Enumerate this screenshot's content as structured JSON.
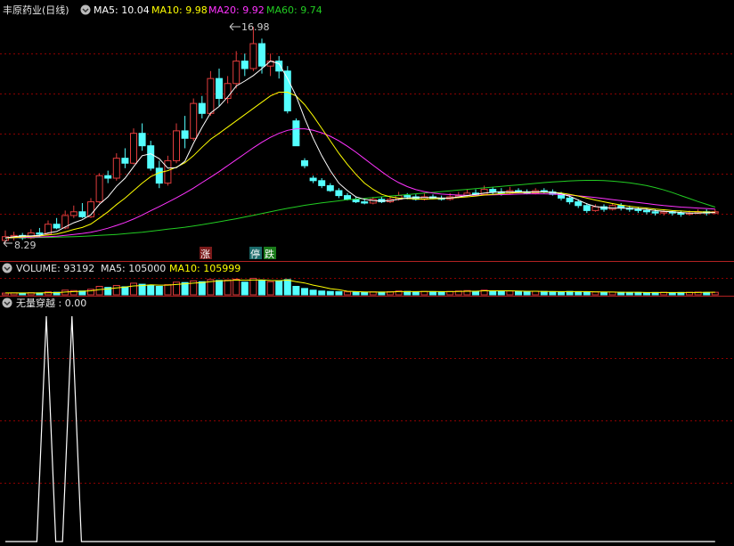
{
  "colors": {
    "bg": "#000000",
    "up": "#e03c3c",
    "down": "#54ffff",
    "ma5": "#ffffff",
    "ma10": "#ffff00",
    "ma20": "#ff33ff",
    "ma60": "#22cc22",
    "grid": "#8b0000",
    "panel_border": "#b22222",
    "label": "#e6e6e6",
    "zhang_bg": "#7a1a1a",
    "ting_bg": "#1a6a6a",
    "die_bg": "#1a7a1a"
  },
  "main": {
    "title": "丰原药业(日线)",
    "ma5_label": "MA5: 10.04",
    "ma10_label": "MA10: 9.98",
    "ma20_label": "MA20: 9.92",
    "ma60_label": "MA60: 9.74",
    "high_label": "16.98",
    "low_label": "8.29",
    "tag_zhang": "涨",
    "tag_ting": "停",
    "tag_die": "跌"
  },
  "volume": {
    "title": "VOLUME: 93192",
    "ma5_label": "MA5: 105000",
    "ma10_label": "MA10: 105999"
  },
  "indicator": {
    "title": "无量穿越 : 0.00"
  },
  "chart_data": {
    "type": "candlestick",
    "price_range": [
      8.29,
      16.98
    ],
    "candles": [
      [
        8.4,
        8.55,
        8.8,
        8.3
      ],
      [
        8.55,
        8.6,
        8.75,
        8.4
      ],
      [
        8.6,
        8.5,
        8.7,
        8.42
      ],
      [
        8.5,
        8.7,
        8.85,
        8.45
      ],
      [
        8.7,
        8.65,
        8.9,
        8.55
      ],
      [
        8.65,
        9.05,
        9.2,
        8.6
      ],
      [
        9.05,
        8.9,
        9.3,
        8.85
      ],
      [
        8.9,
        9.4,
        9.6,
        8.85
      ],
      [
        9.4,
        9.55,
        9.8,
        9.3
      ],
      [
        9.55,
        9.35,
        9.9,
        9.3
      ],
      [
        9.35,
        9.95,
        10.1,
        9.3
      ],
      [
        9.95,
        11.0,
        11.1,
        9.9
      ],
      [
        11.0,
        10.9,
        11.2,
        10.7
      ],
      [
        10.9,
        11.7,
        11.9,
        10.8
      ],
      [
        11.7,
        11.5,
        12.1,
        11.3
      ],
      [
        11.5,
        12.7,
        12.9,
        11.45
      ],
      [
        12.7,
        12.2,
        13.1,
        12.0
      ],
      [
        12.2,
        11.3,
        12.4,
        11.2
      ],
      [
        11.3,
        10.7,
        11.6,
        10.5
      ],
      [
        10.7,
        11.6,
        11.8,
        10.6
      ],
      [
        11.6,
        12.8,
        13.1,
        11.5
      ],
      [
        12.8,
        12.5,
        13.4,
        12.1
      ],
      [
        12.5,
        13.9,
        14.1,
        12.4
      ],
      [
        13.9,
        13.5,
        14.2,
        13.3
      ],
      [
        13.5,
        14.9,
        15.2,
        13.4
      ],
      [
        14.9,
        14.1,
        15.3,
        13.8
      ],
      [
        14.1,
        14.7,
        15.0,
        13.9
      ],
      [
        14.7,
        15.6,
        16.0,
        14.5
      ],
      [
        15.6,
        15.3,
        15.9,
        15.0
      ],
      [
        15.3,
        16.3,
        16.98,
        15.2
      ],
      [
        16.3,
        15.4,
        16.5,
        15.1
      ],
      [
        15.4,
        15.6,
        15.9,
        15.0
      ],
      [
        15.6,
        15.2,
        15.8,
        14.9
      ],
      [
        15.2,
        13.6,
        15.4,
        13.5
      ],
      [
        13.2,
        12.2,
        13.3,
        12.2
      ],
      [
        11.6,
        11.4,
        11.7,
        11.3
      ],
      [
        10.9,
        10.8,
        11.0,
        10.7
      ],
      [
        10.8,
        10.6,
        10.9,
        10.5
      ],
      [
        10.6,
        10.4,
        10.7,
        10.35
      ],
      [
        10.4,
        10.2,
        10.5,
        10.1
      ],
      [
        10.2,
        10.05,
        10.3,
        10.0
      ],
      [
        10.05,
        9.95,
        10.15,
        9.9
      ],
      [
        9.95,
        9.9,
        10.1,
        9.85
      ],
      [
        9.9,
        10.05,
        10.15,
        9.85
      ],
      [
        10.05,
        9.95,
        10.15,
        9.9
      ],
      [
        9.95,
        10.05,
        10.2,
        9.9
      ],
      [
        10.05,
        10.2,
        10.35,
        10.0
      ],
      [
        10.2,
        10.15,
        10.3,
        10.05
      ],
      [
        10.15,
        10.05,
        10.25,
        10.0
      ],
      [
        10.05,
        10.15,
        10.3,
        10.0
      ],
      [
        10.15,
        10.1,
        10.25,
        10.05
      ],
      [
        10.1,
        10.05,
        10.2,
        10.0
      ],
      [
        10.05,
        10.15,
        10.3,
        10.0
      ],
      [
        10.15,
        10.2,
        10.35,
        10.1
      ],
      [
        10.2,
        10.3,
        10.45,
        10.15
      ],
      [
        10.3,
        10.25,
        10.45,
        10.2
      ],
      [
        10.25,
        10.45,
        10.6,
        10.2
      ],
      [
        10.45,
        10.35,
        10.55,
        10.25
      ],
      [
        10.35,
        10.3,
        10.5,
        10.2
      ],
      [
        10.3,
        10.4,
        10.55,
        10.25
      ],
      [
        10.4,
        10.35,
        10.5,
        10.3
      ],
      [
        10.35,
        10.3,
        10.45,
        10.25
      ],
      [
        10.3,
        10.4,
        10.5,
        10.25
      ],
      [
        10.4,
        10.35,
        10.5,
        10.3
      ],
      [
        10.35,
        10.25,
        10.45,
        10.2
      ],
      [
        10.25,
        10.1,
        10.35,
        10.0
      ],
      [
        10.1,
        9.95,
        10.2,
        9.85
      ],
      [
        9.95,
        9.8,
        10.05,
        9.7
      ],
      [
        9.8,
        9.6,
        9.9,
        9.5
      ],
      [
        9.6,
        9.75,
        9.85,
        9.55
      ],
      [
        9.75,
        9.65,
        9.85,
        9.55
      ],
      [
        9.65,
        9.8,
        9.9,
        9.6
      ],
      [
        9.8,
        9.7,
        9.9,
        9.6
      ],
      [
        9.7,
        9.65,
        9.8,
        9.55
      ],
      [
        9.65,
        9.6,
        9.75,
        9.5
      ],
      [
        9.6,
        9.55,
        9.7,
        9.45
      ],
      [
        9.55,
        9.5,
        9.65,
        9.4
      ],
      [
        9.5,
        9.55,
        9.65,
        9.4
      ],
      [
        9.55,
        9.5,
        9.6,
        9.4
      ],
      [
        9.5,
        9.45,
        9.6,
        9.35
      ],
      [
        9.45,
        9.5,
        9.6,
        9.4
      ],
      [
        9.5,
        9.55,
        9.65,
        9.45
      ],
      [
        9.55,
        9.5,
        9.65,
        9.4
      ],
      [
        9.5,
        9.55,
        9.65,
        9.45
      ]
    ],
    "ma5": [
      8.5,
      8.55,
      8.58,
      8.58,
      8.6,
      8.7,
      8.76,
      8.94,
      9.11,
      9.23,
      9.43,
      9.85,
      10.15,
      10.57,
      10.9,
      11.36,
      11.8,
      11.88,
      11.68,
      11.3,
      11.32,
      11.58,
      12.3,
      12.94,
      13.52,
      13.78,
      14.16,
      14.6,
      14.8,
      15.02,
      15.3,
      15.6,
      15.5,
      14.9,
      14.2,
      13.3,
      12.5,
      11.8,
      11.2,
      10.7,
      10.4,
      10.15,
      10.05,
      10.0,
      9.98,
      10.0,
      10.05,
      10.1,
      10.12,
      10.12,
      10.12,
      10.1,
      10.1,
      10.15,
      10.2,
      10.25,
      10.3,
      10.33,
      10.35,
      10.35,
      10.35,
      10.35,
      10.35,
      10.35,
      10.33,
      10.27,
      10.17,
      10.02,
      9.87,
      9.76,
      9.72,
      9.7,
      9.7,
      9.69,
      9.67,
      9.65,
      9.6,
      9.57,
      9.55,
      9.52,
      9.5,
      9.5,
      9.51,
      9.52
    ],
    "ma10": [
      8.5,
      8.52,
      8.54,
      8.56,
      8.58,
      8.62,
      8.66,
      8.74,
      8.84,
      8.92,
      9.06,
      9.3,
      9.55,
      9.84,
      10.1,
      10.4,
      10.7,
      10.96,
      11.12,
      11.2,
      11.34,
      11.52,
      11.8,
      12.14,
      12.46,
      12.7,
      12.95,
      13.2,
      13.45,
      13.7,
      13.95,
      14.2,
      14.35,
      14.35,
      14.2,
      13.85,
      13.4,
      12.9,
      12.4,
      11.9,
      11.45,
      11.05,
      10.7,
      10.45,
      10.25,
      10.15,
      10.1,
      10.08,
      10.06,
      10.06,
      10.07,
      10.08,
      10.1,
      10.12,
      10.15,
      10.18,
      10.22,
      10.25,
      10.28,
      10.3,
      10.32,
      10.33,
      10.34,
      10.34,
      10.33,
      10.3,
      10.25,
      10.18,
      10.1,
      10.02,
      9.95,
      9.88,
      9.82,
      9.77,
      9.73,
      9.7,
      9.66,
      9.63,
      9.6,
      9.58,
      9.56,
      9.55,
      9.54,
      9.53
    ],
    "ma20": [
      8.5,
      8.51,
      8.52,
      8.53,
      8.54,
      8.55,
      8.57,
      8.6,
      8.64,
      8.68,
      8.73,
      8.8,
      8.89,
      9.0,
      9.12,
      9.26,
      9.42,
      9.59,
      9.76,
      9.93,
      10.11,
      10.3,
      10.5,
      10.72,
      10.94,
      11.16,
      11.4,
      11.64,
      11.88,
      12.12,
      12.34,
      12.54,
      12.7,
      12.82,
      12.88,
      12.88,
      12.82,
      12.72,
      12.58,
      12.4,
      12.18,
      11.94,
      11.68,
      11.42,
      11.16,
      10.92,
      10.72,
      10.56,
      10.44,
      10.36,
      10.3,
      10.26,
      10.24,
      10.22,
      10.21,
      10.21,
      10.22,
      10.23,
      10.24,
      10.25,
      10.26,
      10.27,
      10.27,
      10.27,
      10.26,
      10.24,
      10.22,
      10.19,
      10.16,
      10.12,
      10.08,
      10.04,
      10.0,
      9.96,
      9.92,
      9.88,
      9.84,
      9.8,
      9.77,
      9.74,
      9.72,
      9.7,
      9.68,
      9.66
    ],
    "ma60": [
      8.5,
      8.5,
      8.51,
      8.51,
      8.52,
      8.52,
      8.53,
      8.54,
      8.55,
      8.56,
      8.58,
      8.6,
      8.62,
      8.64,
      8.67,
      8.7,
      8.73,
      8.77,
      8.81,
      8.85,
      8.89,
      8.93,
      8.98,
      9.03,
      9.09,
      9.15,
      9.21,
      9.27,
      9.34,
      9.41,
      9.48,
      9.55,
      9.62,
      9.69,
      9.75,
      9.81,
      9.86,
      9.91,
      9.95,
      9.99,
      10.03,
      10.06,
      10.09,
      10.12,
      10.15,
      10.18,
      10.21,
      10.24,
      10.27,
      10.3,
      10.33,
      10.36,
      10.39,
      10.42,
      10.45,
      10.48,
      10.51,
      10.54,
      10.57,
      10.6,
      10.63,
      10.66,
      10.69,
      10.72,
      10.75,
      10.77,
      10.79,
      10.8,
      10.81,
      10.81,
      10.8,
      10.78,
      10.75,
      10.71,
      10.66,
      10.6,
      10.52,
      10.43,
      10.32,
      10.2,
      10.08,
      9.96,
      9.85,
      9.74
    ],
    "volume": [
      [
        8,
        1
      ],
      [
        9,
        1
      ],
      [
        7,
        0
      ],
      [
        10,
        1
      ],
      [
        9,
        0
      ],
      [
        14,
        1
      ],
      [
        12,
        0
      ],
      [
        22,
        1
      ],
      [
        20,
        1
      ],
      [
        18,
        0
      ],
      [
        26,
        1
      ],
      [
        40,
        1
      ],
      [
        35,
        0
      ],
      [
        44,
        1
      ],
      [
        38,
        0
      ],
      [
        55,
        1
      ],
      [
        50,
        0
      ],
      [
        46,
        0
      ],
      [
        40,
        0
      ],
      [
        48,
        1
      ],
      [
        60,
        1
      ],
      [
        58,
        0
      ],
      [
        66,
        1
      ],
      [
        62,
        0
      ],
      [
        72,
        1
      ],
      [
        68,
        0
      ],
      [
        70,
        1
      ],
      [
        74,
        1
      ],
      [
        60,
        0
      ],
      [
        78,
        1
      ],
      [
        70,
        0
      ],
      [
        62,
        1
      ],
      [
        66,
        0
      ],
      [
        72,
        0
      ],
      [
        40,
        0
      ],
      [
        30,
        0
      ],
      [
        22,
        0
      ],
      [
        18,
        0
      ],
      [
        16,
        0
      ],
      [
        15,
        0
      ],
      [
        14,
        1
      ],
      [
        13,
        0
      ],
      [
        12,
        0
      ],
      [
        14,
        1
      ],
      [
        13,
        0
      ],
      [
        15,
        1
      ],
      [
        18,
        1
      ],
      [
        16,
        0
      ],
      [
        14,
        0
      ],
      [
        16,
        1
      ],
      [
        15,
        0
      ],
      [
        14,
        0
      ],
      [
        16,
        1
      ],
      [
        18,
        1
      ],
      [
        20,
        1
      ],
      [
        17,
        0
      ],
      [
        22,
        1
      ],
      [
        19,
        0
      ],
      [
        17,
        0
      ],
      [
        18,
        1
      ],
      [
        16,
        0
      ],
      [
        15,
        0
      ],
      [
        17,
        1
      ],
      [
        16,
        0
      ],
      [
        15,
        0
      ],
      [
        14,
        0
      ],
      [
        16,
        0
      ],
      [
        15,
        0
      ],
      [
        13,
        0
      ],
      [
        14,
        1
      ],
      [
        12,
        0
      ],
      [
        13,
        1
      ],
      [
        12,
        0
      ],
      [
        11,
        0
      ],
      [
        11,
        0
      ],
      [
        10,
        0
      ],
      [
        11,
        0
      ],
      [
        12,
        1
      ],
      [
        10,
        0
      ],
      [
        11,
        0
      ],
      [
        12,
        1
      ],
      [
        13,
        1
      ],
      [
        11,
        0
      ],
      [
        12,
        1
      ]
    ],
    "volume_max": 80,
    "volume_ma5": [
      9,
      9,
      9,
      9,
      9,
      10,
      10,
      13,
      15,
      17,
      19,
      25,
      28,
      33,
      37,
      42,
      44,
      47,
      46,
      46,
      49,
      52,
      55,
      58,
      62,
      66,
      67,
      70,
      69,
      70,
      70,
      68,
      67,
      70,
      62,
      56,
      46,
      38,
      29,
      24,
      17,
      15,
      14,
      13,
      13,
      13,
      15,
      15,
      15,
      16,
      16,
      15,
      15,
      16,
      17,
      17,
      19,
      19,
      19,
      19,
      18,
      17,
      17,
      16,
      16,
      15,
      15,
      15,
      15,
      14,
      14,
      13,
      12,
      12,
      12,
      11,
      11,
      11,
      11,
      11,
      11,
      11,
      12,
      12
    ],
    "indicator": {
      "range": [
        0,
        1
      ],
      "spikes_at_index": [
        5,
        8
      ]
    }
  }
}
